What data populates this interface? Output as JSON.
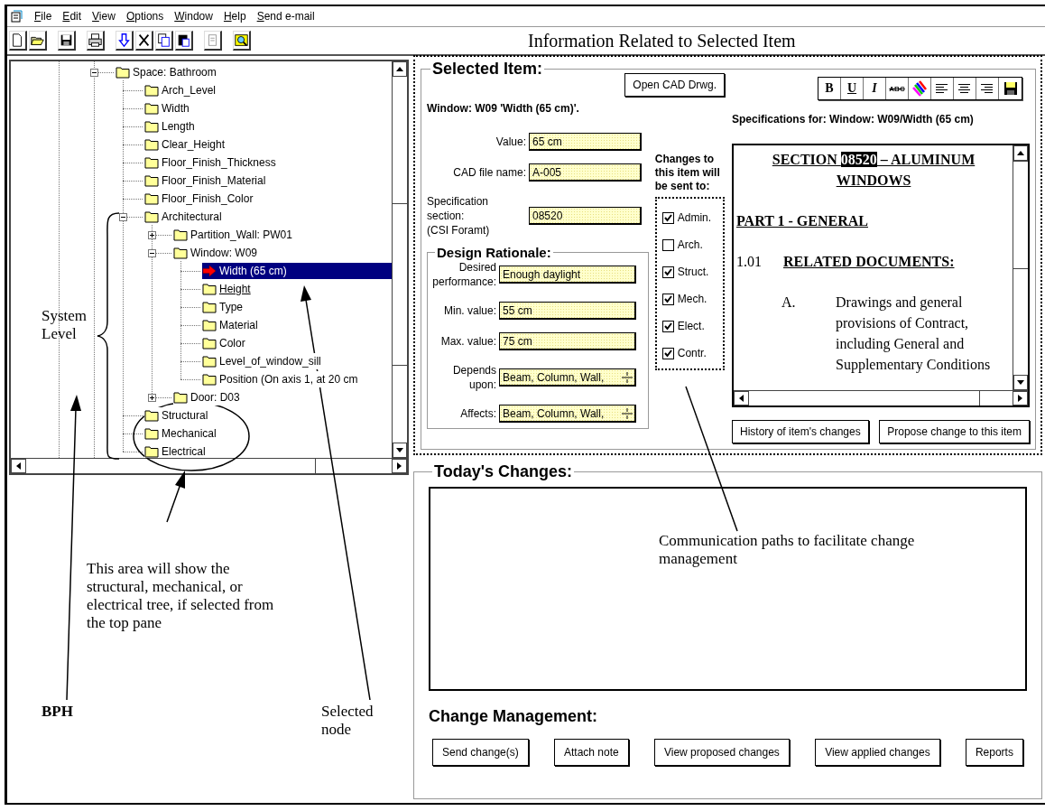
{
  "menu": [
    {
      "label": "File"
    },
    {
      "label": "Edit"
    },
    {
      "label": "View"
    },
    {
      "label": "Options"
    },
    {
      "label": "Window"
    },
    {
      "label": "Help"
    },
    {
      "label": "Send e-mail"
    }
  ],
  "caption": "Information Related to Selected Item",
  "tree": [
    {
      "label": "Space: Bathroom",
      "expanded": true,
      "selected": false,
      "hover": false,
      "children": [
        {
          "label": "Arch_Level",
          "selected": false,
          "hover": false
        },
        {
          "label": "Width",
          "selected": false,
          "hover": false
        },
        {
          "label": "Length",
          "selected": false,
          "hover": false
        },
        {
          "label": "Clear_Height",
          "selected": false,
          "hover": false
        },
        {
          "label": "Floor_Finish_Thickness",
          "selected": false,
          "hover": false
        },
        {
          "label": "Floor_Finish_Material",
          "selected": false,
          "hover": false
        },
        {
          "label": "Floor_Finish_Color",
          "selected": false,
          "hover": false
        },
        {
          "label": "Architectural",
          "expanded": true,
          "selected": false,
          "hover": false,
          "children": [
            {
              "label": "Partition_Wall: PW01",
              "expanded": false,
              "selected": false,
              "hover": false
            },
            {
              "label": "Window: W09",
              "expanded": true,
              "selected": false,
              "hover": false,
              "children": [
                {
                  "label": "Width (65 cm)",
                  "selected": true,
                  "hover": false
                },
                {
                  "label": "Height",
                  "selected": false,
                  "hover": true
                },
                {
                  "label": "Type",
                  "selected": false,
                  "hover": false
                },
                {
                  "label": "Material",
                  "selected": false,
                  "hover": false
                },
                {
                  "label": "Color",
                  "selected": false,
                  "hover": false
                },
                {
                  "label": "Level_of_window_sill",
                  "selected": false,
                  "hover": false
                },
                {
                  "label": "Position (On axis 1, at 20 cm",
                  "selected": false,
                  "hover": false
                }
              ]
            },
            {
              "label": "Door: D03",
              "expanded": false,
              "selected": false,
              "hover": false
            }
          ]
        },
        {
          "label": "Structural",
          "selected": false,
          "hover": false
        },
        {
          "label": "Mechanical",
          "selected": false,
          "hover": false
        },
        {
          "label": "Electrical",
          "selected": false,
          "hover": false
        }
      ]
    }
  ],
  "selected_item": {
    "title": "Selected Item:",
    "open_button": "Open CAD Drwg.",
    "item_label": "Window: W09 'Width (65 cm)'.",
    "fields": [
      {
        "label": "Value:",
        "value": "65 cm"
      },
      {
        "label": "CAD file name:",
        "value": "A-005"
      },
      {
        "label": "Specification section:",
        "sublabel": "(CSI Foramt)",
        "value": "08520"
      }
    ],
    "design_rationale": {
      "title": "Design Rationale:",
      "fields": [
        {
          "kind": "text",
          "label": "Desired performance:",
          "value": "Enough daylight"
        },
        {
          "kind": "text",
          "label": "Min. value:",
          "value": "55 cm"
        },
        {
          "kind": "text",
          "label": "Max. value:",
          "value": "75 cm"
        },
        {
          "kind": "spin",
          "label": "Depends upon:",
          "value": "Beam, Column, Wall,"
        },
        {
          "kind": "spin",
          "label": "Affects:",
          "value": "Beam, Column, Wall,"
        }
      ]
    },
    "recipients_title": "Changes to this item will be sent to:",
    "recipients": [
      {
        "label": "Admin.",
        "checked": true
      },
      {
        "label": "Arch.",
        "checked": false
      },
      {
        "label": "Struct.",
        "checked": true
      },
      {
        "label": "Mech.",
        "checked": true
      },
      {
        "label": "Elect.",
        "checked": true
      },
      {
        "label": "Contr.",
        "checked": true
      }
    ],
    "format_buttons": [
      "B",
      "U",
      "I",
      "ABC"
    ],
    "spec_title": "Specifications for: Window: W09/Width (65 cm)",
    "document": {
      "heading_runs": [
        {
          "text": "SECTION ",
          "selected": false
        },
        {
          "text": "08520",
          "selected": true
        },
        {
          "text": " – ALUMINUM WINDOWS",
          "selected": false
        }
      ],
      "part": "PART 1 - GENERAL",
      "clause_number": "1.01",
      "clause_title": "RELATED DOCUMENTS:",
      "item_letter": "A.",
      "item_text": "Drawings and general provisions of Contract, including General and Supplementary Conditions"
    },
    "buttons": [
      "History of item's changes",
      "Propose change to this item"
    ]
  },
  "todays_changes": {
    "title": "Today's Changes:"
  },
  "change_management": {
    "title": "Change Management:",
    "buttons": [
      "Send change(s)",
      "Attach note",
      "View proposed changes",
      "View applied changes",
      "Reports"
    ]
  },
  "annotations": [
    {
      "text": "System Level"
    },
    {
      "text": "This area will show the structural, mechanical, or electrical tree, if selected from the top pane"
    },
    {
      "text": "BPH"
    },
    {
      "text": "Selected node"
    },
    {
      "text": "Communication paths to facilitate change management"
    }
  ]
}
